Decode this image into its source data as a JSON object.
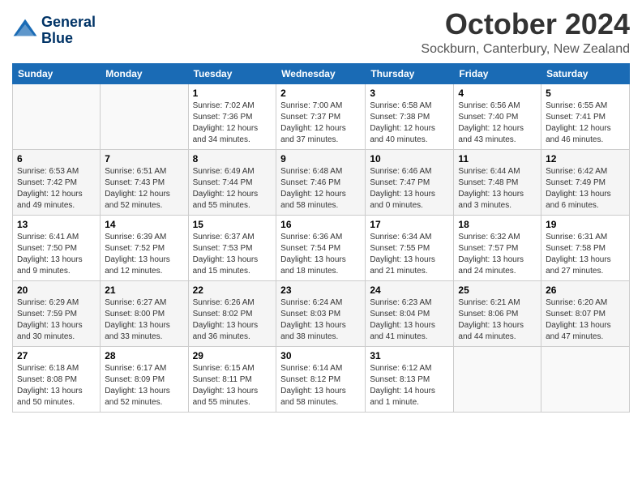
{
  "header": {
    "logo_line1": "General",
    "logo_line2": "Blue",
    "month": "October 2024",
    "location": "Sockburn, Canterbury, New Zealand"
  },
  "weekdays": [
    "Sunday",
    "Monday",
    "Tuesday",
    "Wednesday",
    "Thursday",
    "Friday",
    "Saturday"
  ],
  "weeks": [
    [
      {
        "day": "",
        "info": ""
      },
      {
        "day": "",
        "info": ""
      },
      {
        "day": "1",
        "info": "Sunrise: 7:02 AM\nSunset: 7:36 PM\nDaylight: 12 hours\nand 34 minutes."
      },
      {
        "day": "2",
        "info": "Sunrise: 7:00 AM\nSunset: 7:37 PM\nDaylight: 12 hours\nand 37 minutes."
      },
      {
        "day": "3",
        "info": "Sunrise: 6:58 AM\nSunset: 7:38 PM\nDaylight: 12 hours\nand 40 minutes."
      },
      {
        "day": "4",
        "info": "Sunrise: 6:56 AM\nSunset: 7:40 PM\nDaylight: 12 hours\nand 43 minutes."
      },
      {
        "day": "5",
        "info": "Sunrise: 6:55 AM\nSunset: 7:41 PM\nDaylight: 12 hours\nand 46 minutes."
      }
    ],
    [
      {
        "day": "6",
        "info": "Sunrise: 6:53 AM\nSunset: 7:42 PM\nDaylight: 12 hours\nand 49 minutes."
      },
      {
        "day": "7",
        "info": "Sunrise: 6:51 AM\nSunset: 7:43 PM\nDaylight: 12 hours\nand 52 minutes."
      },
      {
        "day": "8",
        "info": "Sunrise: 6:49 AM\nSunset: 7:44 PM\nDaylight: 12 hours\nand 55 minutes."
      },
      {
        "day": "9",
        "info": "Sunrise: 6:48 AM\nSunset: 7:46 PM\nDaylight: 12 hours\nand 58 minutes."
      },
      {
        "day": "10",
        "info": "Sunrise: 6:46 AM\nSunset: 7:47 PM\nDaylight: 13 hours\nand 0 minutes."
      },
      {
        "day": "11",
        "info": "Sunrise: 6:44 AM\nSunset: 7:48 PM\nDaylight: 13 hours\nand 3 minutes."
      },
      {
        "day": "12",
        "info": "Sunrise: 6:42 AM\nSunset: 7:49 PM\nDaylight: 13 hours\nand 6 minutes."
      }
    ],
    [
      {
        "day": "13",
        "info": "Sunrise: 6:41 AM\nSunset: 7:50 PM\nDaylight: 13 hours\nand 9 minutes."
      },
      {
        "day": "14",
        "info": "Sunrise: 6:39 AM\nSunset: 7:52 PM\nDaylight: 13 hours\nand 12 minutes."
      },
      {
        "day": "15",
        "info": "Sunrise: 6:37 AM\nSunset: 7:53 PM\nDaylight: 13 hours\nand 15 minutes."
      },
      {
        "day": "16",
        "info": "Sunrise: 6:36 AM\nSunset: 7:54 PM\nDaylight: 13 hours\nand 18 minutes."
      },
      {
        "day": "17",
        "info": "Sunrise: 6:34 AM\nSunset: 7:55 PM\nDaylight: 13 hours\nand 21 minutes."
      },
      {
        "day": "18",
        "info": "Sunrise: 6:32 AM\nSunset: 7:57 PM\nDaylight: 13 hours\nand 24 minutes."
      },
      {
        "day": "19",
        "info": "Sunrise: 6:31 AM\nSunset: 7:58 PM\nDaylight: 13 hours\nand 27 minutes."
      }
    ],
    [
      {
        "day": "20",
        "info": "Sunrise: 6:29 AM\nSunset: 7:59 PM\nDaylight: 13 hours\nand 30 minutes."
      },
      {
        "day": "21",
        "info": "Sunrise: 6:27 AM\nSunset: 8:00 PM\nDaylight: 13 hours\nand 33 minutes."
      },
      {
        "day": "22",
        "info": "Sunrise: 6:26 AM\nSunset: 8:02 PM\nDaylight: 13 hours\nand 36 minutes."
      },
      {
        "day": "23",
        "info": "Sunrise: 6:24 AM\nSunset: 8:03 PM\nDaylight: 13 hours\nand 38 minutes."
      },
      {
        "day": "24",
        "info": "Sunrise: 6:23 AM\nSunset: 8:04 PM\nDaylight: 13 hours\nand 41 minutes."
      },
      {
        "day": "25",
        "info": "Sunrise: 6:21 AM\nSunset: 8:06 PM\nDaylight: 13 hours\nand 44 minutes."
      },
      {
        "day": "26",
        "info": "Sunrise: 6:20 AM\nSunset: 8:07 PM\nDaylight: 13 hours\nand 47 minutes."
      }
    ],
    [
      {
        "day": "27",
        "info": "Sunrise: 6:18 AM\nSunset: 8:08 PM\nDaylight: 13 hours\nand 50 minutes."
      },
      {
        "day": "28",
        "info": "Sunrise: 6:17 AM\nSunset: 8:09 PM\nDaylight: 13 hours\nand 52 minutes."
      },
      {
        "day": "29",
        "info": "Sunrise: 6:15 AM\nSunset: 8:11 PM\nDaylight: 13 hours\nand 55 minutes."
      },
      {
        "day": "30",
        "info": "Sunrise: 6:14 AM\nSunset: 8:12 PM\nDaylight: 13 hours\nand 58 minutes."
      },
      {
        "day": "31",
        "info": "Sunrise: 6:12 AM\nSunset: 8:13 PM\nDaylight: 14 hours\nand 1 minute."
      },
      {
        "day": "",
        "info": ""
      },
      {
        "day": "",
        "info": ""
      }
    ]
  ]
}
